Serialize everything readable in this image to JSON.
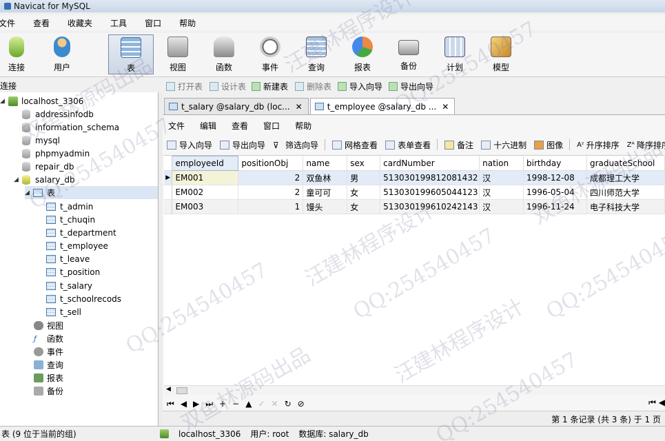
{
  "window": {
    "title": "Navicat for MySQL"
  },
  "menubar": {
    "items": [
      "文件",
      "查看",
      "收藏夹",
      "工具",
      "窗口",
      "帮助"
    ]
  },
  "toolbar": {
    "buttons": [
      {
        "label": "连接",
        "icon": "connect-icon"
      },
      {
        "label": "用户",
        "icon": "user-icon"
      },
      {
        "label": "表",
        "icon": "table-icon",
        "active": true
      },
      {
        "label": "视图",
        "icon": "view-icon"
      },
      {
        "label": "函数",
        "icon": "function-icon"
      },
      {
        "label": "事件",
        "icon": "event-icon"
      },
      {
        "label": "查询",
        "icon": "query-icon"
      },
      {
        "label": "报表",
        "icon": "report-icon"
      },
      {
        "label": "备份",
        "icon": "backup-icon"
      },
      {
        "label": "计划",
        "icon": "schedule-icon"
      },
      {
        "label": "模型",
        "icon": "model-icon"
      }
    ]
  },
  "connection_label": "连接",
  "object_tools": [
    "打开表",
    "设计表",
    "新建表",
    "删除表",
    "导入向导",
    "导出向导"
  ],
  "sidebar": {
    "server": "localhost_3306",
    "databases": [
      "addressinfodb",
      "information_schema",
      "mysql",
      "phpmyadmin",
      "repair_db",
      "salary_db"
    ],
    "tables_node": "表",
    "tables": [
      "t_admin",
      "t_chuqin",
      "t_department",
      "t_employee",
      "t_leave",
      "t_position",
      "t_salary",
      "t_schoolrecods",
      "t_sell"
    ],
    "other_nodes": [
      "视图",
      "函数",
      "事件",
      "查询",
      "报表",
      "备份"
    ]
  },
  "tabs": [
    {
      "label": "t_salary @salary_db (loc..."
    },
    {
      "label": "t_employee @salary_db ..."
    }
  ],
  "inner_menu": [
    "文件",
    "编辑",
    "查看",
    "窗口",
    "帮助"
  ],
  "inner_tools": [
    "导入向导",
    "导出向导",
    "筛选向导",
    "网格查看",
    "表单查看",
    "备注",
    "十六进制",
    "图像",
    "升序排序",
    "降序排序"
  ],
  "grid": {
    "columns": [
      "employeeId",
      "positionObj",
      "name",
      "sex",
      "cardNumber",
      "nation",
      "birthday",
      "graduateSchool"
    ],
    "rows": [
      [
        "EM001",
        "2",
        "双鱼林",
        "男",
        "513030199812081432",
        "汉",
        "1998-12-08",
        "成都理工大学"
      ],
      [
        "EM002",
        "2",
        "童可可",
        "女",
        "513030199605044123",
        "汉",
        "1996-05-04",
        "四川师范大学"
      ],
      [
        "EM003",
        "1",
        "馒头",
        "女",
        "513030199610242143",
        "汉",
        "1996-11-24",
        "电子科技大学"
      ]
    ]
  },
  "record_info": "第 1 条记录 (共 3 条) 于 1 页",
  "status": {
    "left": "表 (9 位于当前的组)",
    "connection": "localhost_3306",
    "user": "用户: root",
    "database": "数据库: salary_db"
  },
  "watermarks": [
    "QQ:254540457",
    "双鱼林源码出品",
    "汪建林程序设计"
  ]
}
